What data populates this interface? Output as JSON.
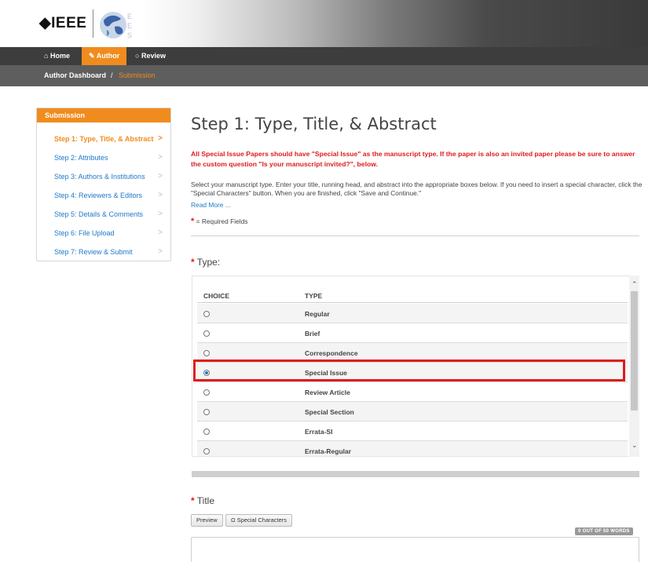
{
  "header": {
    "logo_text": "IEEE"
  },
  "nav": {
    "home": "Home",
    "author": "Author",
    "review": "Review"
  },
  "breadcrumb": {
    "main": "Author Dashboard",
    "separator": "/",
    "current": "Submission"
  },
  "sidebar": {
    "heading": "Submission",
    "items": [
      {
        "label": "Step 1: Type, Title, & Abstract"
      },
      {
        "label": "Step 2: Attributes"
      },
      {
        "label": "Step 3: Authors & Institutions"
      },
      {
        "label": "Step 4: Reviewers & Editors"
      },
      {
        "label": "Step 5: Details & Comments"
      },
      {
        "label": "Step 6: File Upload"
      },
      {
        "label": "Step 7: Review & Submit"
      }
    ]
  },
  "main": {
    "title": "Step 1: Type, Title, & Abstract",
    "warning": "All Special Issue Papers should have \"Special Issue\" as the manuscript type. If the paper is also an invited paper please be sure to answer the custom question \"Is your manuscript invited?\", below.",
    "instructions": "Select your manuscript type. Enter your title, running head, and abstract into the appropriate boxes below. If you need to insert a special character, click the \"Special Characters\" button. When you are finished, click \"Save and Continue.\"",
    "read_more": "Read More ...",
    "required_note": "= Required Fields",
    "type_label": "Type:",
    "title_label": "Title"
  },
  "type_table": {
    "headers": {
      "choice": "CHOICE",
      "type": "TYPE"
    },
    "rows": [
      {
        "name": "Regular"
      },
      {
        "name": "Brief"
      },
      {
        "name": "Correspondence"
      },
      {
        "name": "Special Issue"
      },
      {
        "name": "Review Article"
      },
      {
        "name": "Special Section"
      },
      {
        "name": "Errata-SI"
      },
      {
        "name": "Errata-Regular"
      }
    ],
    "selected": "Special Issue"
  },
  "editor": {
    "preview_label": "Preview",
    "special_chars_label": "Ω Special Characters",
    "word_count": "0 OUT OF 50 WORDS"
  },
  "colors": {
    "accent": "#f08c1e",
    "link": "#1e78c8",
    "warning": "#e01b1b"
  }
}
